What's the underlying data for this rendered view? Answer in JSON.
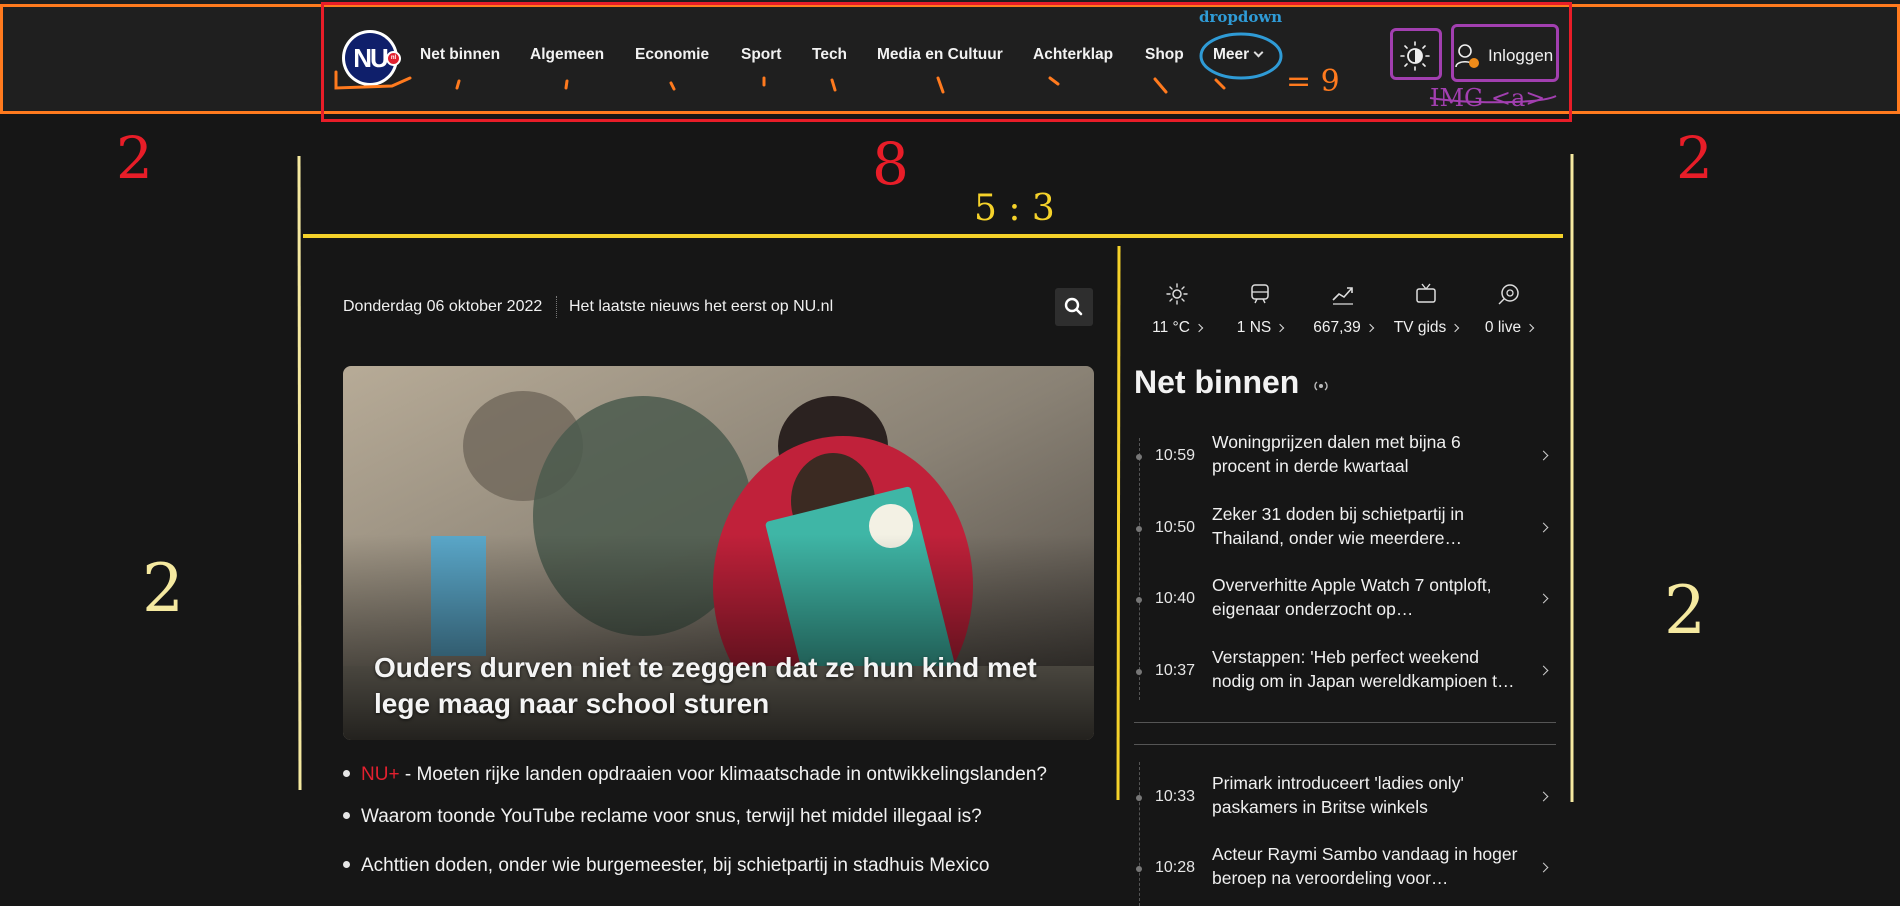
{
  "nav": {
    "logo_text": "NU",
    "logo_badge": "nl",
    "items": [
      {
        "label": "Net binnen"
      },
      {
        "label": "Algemeen"
      },
      {
        "label": "Economie"
      },
      {
        "label": "Sport"
      },
      {
        "label": "Tech"
      },
      {
        "label": "Media en Cultuur"
      },
      {
        "label": "Achterklap"
      },
      {
        "label": "Shop"
      },
      {
        "label": "Meer"
      }
    ],
    "login_label": "Inloggen",
    "theme_icon": "contrast-icon",
    "user_icon": "user-icon"
  },
  "annotations": {
    "dropdown": "dropdown",
    "nine": "= 9",
    "img_a": "IMG <a>",
    "two_left": "2",
    "two_right": "2",
    "eight": "8",
    "ratio": "5 : 3",
    "two_left_lower": "2",
    "two_right_lower": "2",
    "colors": {
      "red": "#e81d28",
      "orange": "#ff7a1e",
      "yellow": "#f5d22a",
      "blue": "#2f9bd6",
      "purple": "#a23fb0"
    }
  },
  "main": {
    "date": "Donderdag 06 oktober 2022",
    "tagline": "Het laatste nieuws het eerst op NU.nl",
    "search_icon": "search-icon",
    "hero_title": "Ouders durven niet te zeggen dat ze hun kind met lege maag naar school sturen",
    "bullets": [
      {
        "prefix": "NU+",
        "sep": " - ",
        "text": "Moeten rijke landen opdraaien voor klimaatschade in ontwikkelingslanden?"
      },
      {
        "prefix": "",
        "sep": "",
        "text": "Waarom toonde YouTube reclame voor snus, terwijl het middel illegaal is?"
      },
      {
        "prefix": "",
        "sep": "",
        "text": "Achttien doden, onder wie burgemeester, bij schietpartij in stadhuis Mexico"
      }
    ]
  },
  "sidebar": {
    "widgets": [
      {
        "icon": "sun-icon",
        "label": "11 °C"
      },
      {
        "icon": "train-icon",
        "label": "1 NS"
      },
      {
        "icon": "stocks-icon",
        "label": "667,39"
      },
      {
        "icon": "tv-icon",
        "label": "TV gids"
      },
      {
        "icon": "football-icon",
        "label": "0 live"
      }
    ],
    "title": "Net binnen",
    "live_icon": "live-icon",
    "news": [
      {
        "time": "10:59",
        "title": "Woningprijzen dalen met bijna 6 procent in derde kwartaal"
      },
      {
        "time": "10:50",
        "title": "Zeker 31 doden bij schietpartij in Thailand, onder wie meerdere…"
      },
      {
        "time": "10:40",
        "title": "Oververhitte Apple Watch 7 ontploft, eigenaar onderzocht op…"
      },
      {
        "time": "10:37",
        "title": "Verstappen: 'Heb perfect weekend nodig om in Japan wereldkampioen t…"
      },
      {
        "time": "10:33",
        "title": "Primark introduceert 'ladies only' paskamers in Britse winkels"
      },
      {
        "time": "10:28",
        "title": "Acteur Raymi Sambo vandaag in hoger beroep na veroordeling voor…"
      }
    ]
  }
}
